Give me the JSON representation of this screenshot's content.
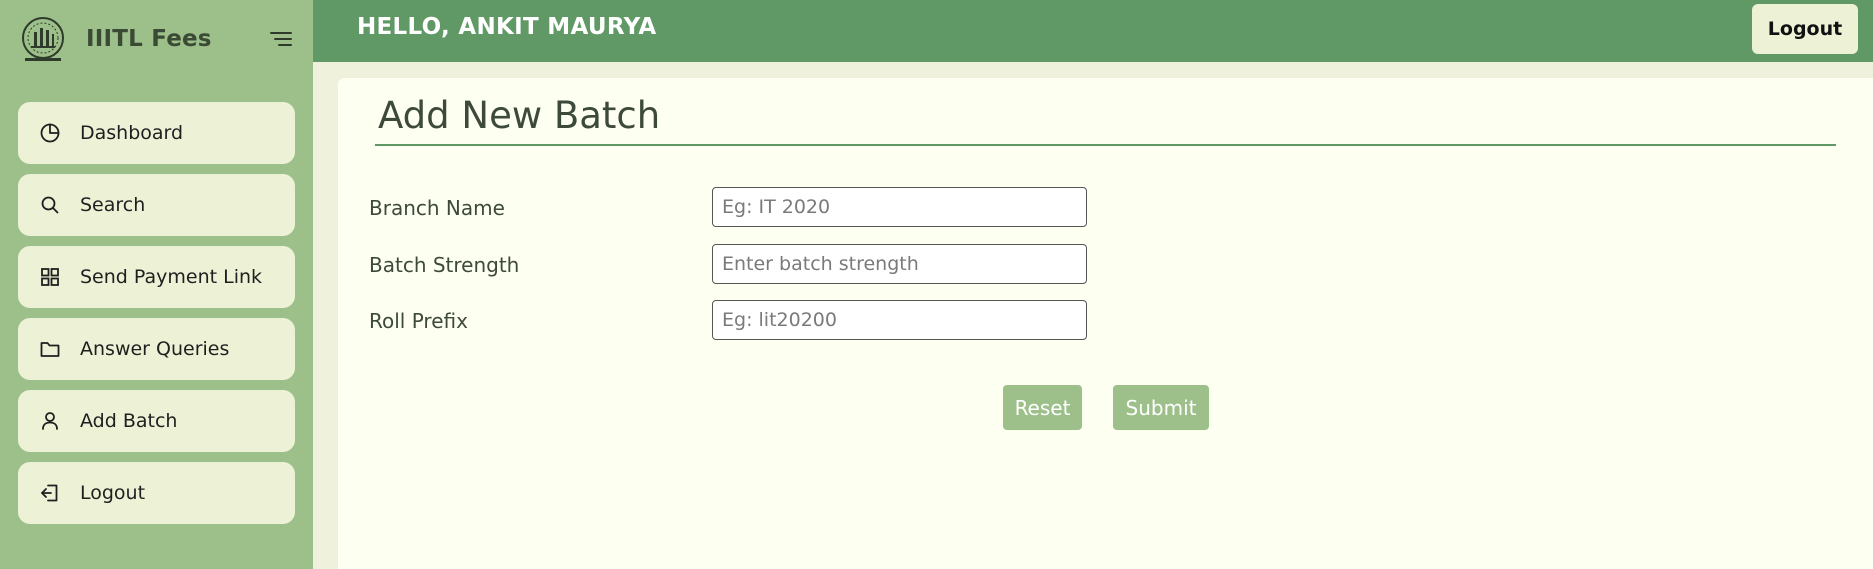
{
  "app": {
    "title": "IIITL Fees"
  },
  "sidebar": {
    "items": [
      {
        "label": "Dashboard",
        "icon": "pie-chart-icon"
      },
      {
        "label": "Search",
        "icon": "search-icon"
      },
      {
        "label": "Send Payment Link",
        "icon": "grid-icon"
      },
      {
        "label": "Answer Queries",
        "icon": "folder-icon"
      },
      {
        "label": "Add Batch",
        "icon": "user-icon"
      },
      {
        "label": "Logout",
        "icon": "logout-icon"
      }
    ]
  },
  "header": {
    "greeting": "HELLO, ANKIT MAURYA",
    "logout_label": "Logout"
  },
  "main": {
    "title": "Add New Batch",
    "form": {
      "fields": [
        {
          "label": "Branch Name",
          "placeholder": "Eg: IT 2020",
          "value": ""
        },
        {
          "label": "Batch Strength",
          "placeholder": "Enter batch strength",
          "value": ""
        },
        {
          "label": "Roll Prefix",
          "placeholder": "Eg: lit20200",
          "value": ""
        }
      ],
      "reset_label": "Reset",
      "submit_label": "Submit"
    }
  },
  "colors": {
    "sidebar_bg": "#9dc08b",
    "header_bg": "#609966",
    "nav_item_bg": "#edf1d6",
    "main_bg": "#fdfff0",
    "button_bg": "#9dc08b"
  }
}
